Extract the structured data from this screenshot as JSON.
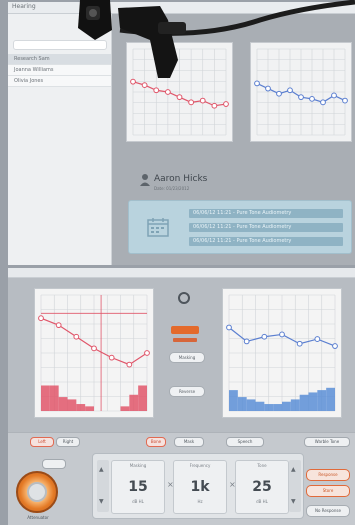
{
  "top_screen": {
    "window_title": "Hearing",
    "sidebar": {
      "search_placeholder": "",
      "items": [
        "Research Sam",
        "Joanna Williams",
        "Olivia Jones"
      ]
    },
    "audiogram_left": {
      "color": "#e0566a",
      "points": [
        [
          0,
          38
        ],
        [
          1,
          42
        ],
        [
          2,
          48
        ],
        [
          3,
          50
        ],
        [
          4,
          56
        ],
        [
          5,
          62
        ],
        [
          6,
          60
        ],
        [
          7,
          66
        ],
        [
          8,
          64
        ]
      ]
    },
    "audiogram_right": {
      "color": "#5b7fd0",
      "points": [
        [
          0,
          40
        ],
        [
          1,
          46
        ],
        [
          2,
          52
        ],
        [
          3,
          48
        ],
        [
          4,
          56
        ],
        [
          5,
          58
        ],
        [
          6,
          62
        ],
        [
          7,
          54
        ],
        [
          8,
          60
        ]
      ]
    },
    "patient": {
      "name": "Aaron Hicks",
      "id": "Date: 01/23/2012",
      "tag": ""
    },
    "sessions": [
      "06/06/12 11:21 - Pure Tone Audiometry",
      "06/06/12 11:21 - Pure Tone Audiometry",
      "06/06/12 11:21 - Pure Tone Audiometry"
    ]
  },
  "bottom_screen": {
    "window_title": "",
    "right_status": "",
    "left_chart": {
      "color": "#e0566a",
      "points": [
        [
          0,
          20
        ],
        [
          1,
          26
        ],
        [
          2,
          36
        ],
        [
          3,
          46
        ],
        [
          4,
          54
        ],
        [
          5,
          60
        ],
        [
          6,
          50
        ]
      ]
    },
    "right_chart": {
      "color": "#5b7fd0",
      "points": [
        [
          0,
          28
        ],
        [
          1,
          40
        ],
        [
          2,
          36
        ],
        [
          3,
          34
        ],
        [
          4,
          42
        ],
        [
          5,
          38
        ],
        [
          6,
          44
        ]
      ]
    },
    "center": {
      "button_1": "Masking",
      "button_2": "Reverse"
    },
    "controls": {
      "top_buttons": [
        "Left",
        "Right",
        "Bone",
        "Mask",
        "Speech",
        "Warble Tone"
      ],
      "knob_label": "Attenuator",
      "level": {
        "label": "Masking",
        "value": "15",
        "unit": "dB HL"
      },
      "frequency": {
        "label": "Frequency",
        "value": "1k",
        "unit": "Hz"
      },
      "gain": {
        "label": "Tone",
        "value": "25",
        "unit": "dB HL"
      },
      "right_buttons": [
        "Response",
        "Store",
        "No Response"
      ]
    }
  }
}
